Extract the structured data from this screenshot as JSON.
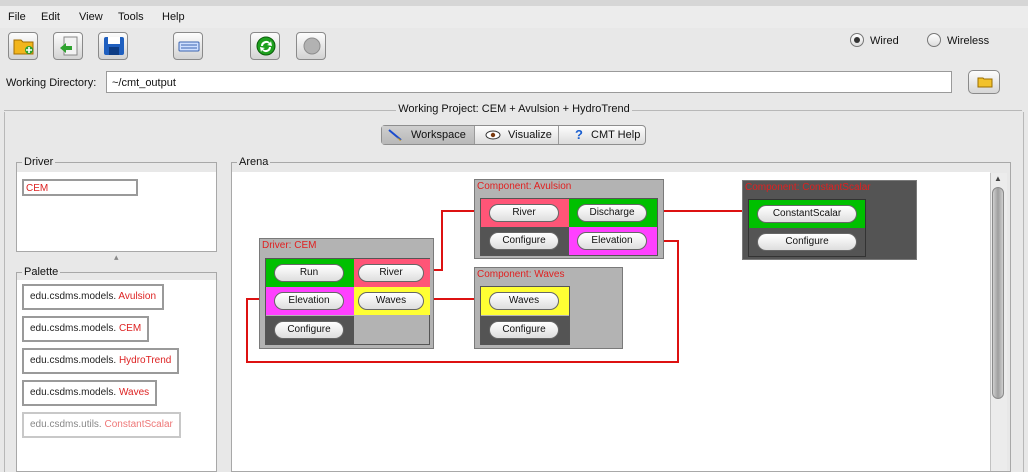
{
  "menu": {
    "file": "File",
    "edit": "Edit",
    "view": "View",
    "tools": "Tools",
    "help": "Help"
  },
  "connection": {
    "wired": "Wired",
    "wireless": "Wireless",
    "selected": "Wired"
  },
  "working_directory": {
    "label": "Working Directory:",
    "value": "~/cmt_output"
  },
  "project": {
    "title": "Working Project: CEM + Avulsion + HydroTrend"
  },
  "tabs": [
    {
      "label": "Workspace",
      "selected": true
    },
    {
      "label": "Visualize",
      "selected": false
    },
    {
      "label": "CMT Help",
      "selected": false
    }
  ],
  "driver_panel": {
    "title": "Driver",
    "value": "CEM"
  },
  "palette": {
    "title": "Palette",
    "items": [
      {
        "pkg": "edu.csdms.models.",
        "name": "Avulsion"
      },
      {
        "pkg": "edu.csdms.models.",
        "name": "CEM"
      },
      {
        "pkg": "edu.csdms.models.",
        "name": "HydroTrend"
      },
      {
        "pkg": "edu.csdms.models.",
        "name": "Waves"
      },
      {
        "pkg": "edu.csdms.utils.",
        "name": "ConstantScalar"
      }
    ]
  },
  "arena": {
    "title": "Arena",
    "driver": {
      "title": "Driver: CEM",
      "ports": [
        "Run",
        "River",
        "Elevation",
        "Waves",
        "Configure"
      ]
    },
    "avulsion": {
      "title": "Component: Avulsion",
      "ports": [
        "River",
        "Discharge",
        "Configure",
        "Elevation"
      ]
    },
    "waves": {
      "title": "Component: Waves",
      "ports": [
        "Waves",
        "Configure"
      ]
    },
    "constant": {
      "title": "Component: ConstantScalar",
      "ports": [
        "ConstantScalar",
        "Configure"
      ]
    }
  },
  "colors": {
    "green": "#00c000",
    "magenta": "#ff40ff",
    "yellow": "#ffff33",
    "pink": "#ff5577",
    "dark": "#545454",
    "wire": "#dd1111",
    "title_red": "#e02020"
  }
}
